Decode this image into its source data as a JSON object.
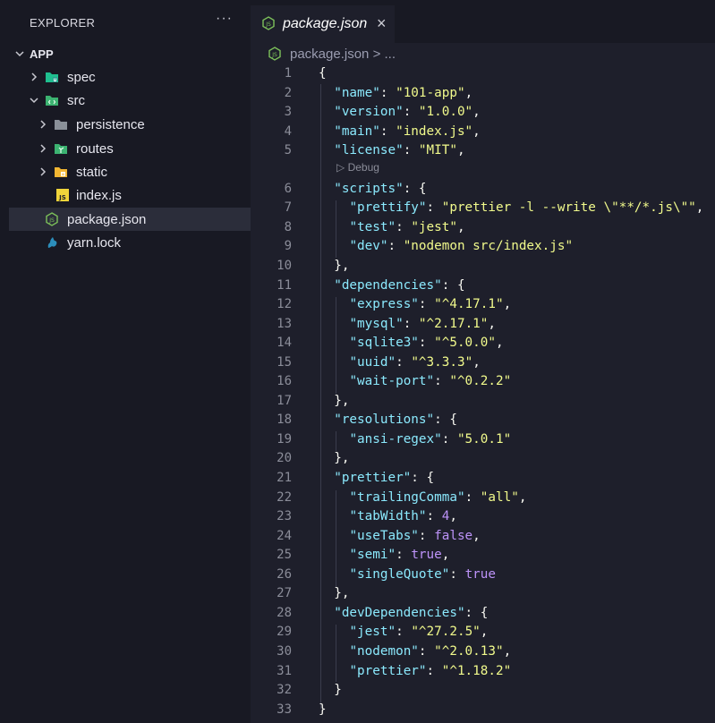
{
  "explorer": {
    "title": "EXPLORER",
    "more": "···",
    "root": "APP",
    "items": [
      {
        "label": "spec",
        "kind": "folder",
        "icon": "test-folder-icon"
      },
      {
        "label": "src",
        "kind": "folder",
        "icon": "src-folder-icon"
      },
      {
        "label": "persistence",
        "kind": "folder",
        "icon": "folder-icon"
      },
      {
        "label": "routes",
        "kind": "folder",
        "icon": "routes-folder-icon"
      },
      {
        "label": "static",
        "kind": "folder",
        "icon": "static-folder-icon"
      },
      {
        "label": "index.js",
        "kind": "file",
        "icon": "js-file-icon"
      },
      {
        "label": "package.json",
        "kind": "file",
        "icon": "nodejs-icon"
      },
      {
        "label": "yarn.lock",
        "kind": "file",
        "icon": "yarn-icon"
      }
    ]
  },
  "tab": {
    "label": "package.json",
    "close": "×"
  },
  "breadcrumb": "package.json > ...",
  "codelens": "▷ Debug",
  "lines": [
    {
      "n": "1",
      "t": [
        [
          "p",
          "{"
        ]
      ]
    },
    {
      "n": "2",
      "t": [
        [
          "p",
          "  "
        ],
        [
          "k",
          "\"name\""
        ],
        [
          "p",
          ": "
        ],
        [
          "s",
          "\"101-app\""
        ],
        [
          "p",
          ","
        ]
      ]
    },
    {
      "n": "3",
      "t": [
        [
          "p",
          "  "
        ],
        [
          "k",
          "\"version\""
        ],
        [
          "p",
          ": "
        ],
        [
          "s",
          "\"1.0.0\""
        ],
        [
          "p",
          ","
        ]
      ]
    },
    {
      "n": "4",
      "t": [
        [
          "p",
          "  "
        ],
        [
          "k",
          "\"main\""
        ],
        [
          "p",
          ": "
        ],
        [
          "s",
          "\"index.js\""
        ],
        [
          "p",
          ","
        ]
      ]
    },
    {
      "n": "5",
      "t": [
        [
          "p",
          "  "
        ],
        [
          "k",
          "\"license\""
        ],
        [
          "p",
          ": "
        ],
        [
          "s",
          "\"MIT\""
        ],
        [
          "p",
          ","
        ]
      ]
    },
    {
      "n": "6",
      "t": [
        [
          "p",
          "  "
        ],
        [
          "k",
          "\"scripts\""
        ],
        [
          "p",
          ": {"
        ]
      ]
    },
    {
      "n": "7",
      "t": [
        [
          "p",
          "    "
        ],
        [
          "k",
          "\"prettify\""
        ],
        [
          "p",
          ": "
        ],
        [
          "s",
          "\"prettier -l --write \\\"**/*.js\\\"\""
        ],
        [
          "p",
          ","
        ]
      ]
    },
    {
      "n": "8",
      "t": [
        [
          "p",
          "    "
        ],
        [
          "k",
          "\"test\""
        ],
        [
          "p",
          ": "
        ],
        [
          "s",
          "\"jest\""
        ],
        [
          "p",
          ","
        ]
      ]
    },
    {
      "n": "9",
      "t": [
        [
          "p",
          "    "
        ],
        [
          "k",
          "\"dev\""
        ],
        [
          "p",
          ": "
        ],
        [
          "s",
          "\"nodemon src/index.js\""
        ]
      ]
    },
    {
      "n": "10",
      "t": [
        [
          "p",
          "  },"
        ]
      ]
    },
    {
      "n": "11",
      "t": [
        [
          "p",
          "  "
        ],
        [
          "k",
          "\"dependencies\""
        ],
        [
          "p",
          ": {"
        ]
      ]
    },
    {
      "n": "12",
      "t": [
        [
          "p",
          "    "
        ],
        [
          "k",
          "\"express\""
        ],
        [
          "p",
          ": "
        ],
        [
          "s",
          "\"^4.17.1\""
        ],
        [
          "p",
          ","
        ]
      ]
    },
    {
      "n": "13",
      "t": [
        [
          "p",
          "    "
        ],
        [
          "k",
          "\"mysql\""
        ],
        [
          "p",
          ": "
        ],
        [
          "s",
          "\"^2.17.1\""
        ],
        [
          "p",
          ","
        ]
      ]
    },
    {
      "n": "14",
      "t": [
        [
          "p",
          "    "
        ],
        [
          "k",
          "\"sqlite3\""
        ],
        [
          "p",
          ": "
        ],
        [
          "s",
          "\"^5.0.0\""
        ],
        [
          "p",
          ","
        ]
      ]
    },
    {
      "n": "15",
      "t": [
        [
          "p",
          "    "
        ],
        [
          "k",
          "\"uuid\""
        ],
        [
          "p",
          ": "
        ],
        [
          "s",
          "\"^3.3.3\""
        ],
        [
          "p",
          ","
        ]
      ]
    },
    {
      "n": "16",
      "t": [
        [
          "p",
          "    "
        ],
        [
          "k",
          "\"wait-port\""
        ],
        [
          "p",
          ": "
        ],
        [
          "s",
          "\"^0.2.2\""
        ]
      ]
    },
    {
      "n": "17",
      "t": [
        [
          "p",
          "  },"
        ]
      ]
    },
    {
      "n": "18",
      "t": [
        [
          "p",
          "  "
        ],
        [
          "k",
          "\"resolutions\""
        ],
        [
          "p",
          ": {"
        ]
      ]
    },
    {
      "n": "19",
      "t": [
        [
          "p",
          "    "
        ],
        [
          "k",
          "\"ansi-regex\""
        ],
        [
          "p",
          ": "
        ],
        [
          "s",
          "\"5.0.1\""
        ]
      ]
    },
    {
      "n": "20",
      "t": [
        [
          "p",
          "  },"
        ]
      ]
    },
    {
      "n": "21",
      "t": [
        [
          "p",
          "  "
        ],
        [
          "k",
          "\"prettier\""
        ],
        [
          "p",
          ": {"
        ]
      ]
    },
    {
      "n": "22",
      "t": [
        [
          "p",
          "    "
        ],
        [
          "k",
          "\"trailingComma\""
        ],
        [
          "p",
          ": "
        ],
        [
          "s",
          "\"all\""
        ],
        [
          "p",
          ","
        ]
      ]
    },
    {
      "n": "23",
      "t": [
        [
          "p",
          "    "
        ],
        [
          "k",
          "\"tabWidth\""
        ],
        [
          "p",
          ": "
        ],
        [
          "n",
          "4"
        ],
        [
          "p",
          ","
        ]
      ]
    },
    {
      "n": "24",
      "t": [
        [
          "p",
          "    "
        ],
        [
          "k",
          "\"useTabs\""
        ],
        [
          "p",
          ": "
        ],
        [
          "b",
          "false"
        ],
        [
          "p",
          ","
        ]
      ]
    },
    {
      "n": "25",
      "t": [
        [
          "p",
          "    "
        ],
        [
          "k",
          "\"semi\""
        ],
        [
          "p",
          ": "
        ],
        [
          "b",
          "true"
        ],
        [
          "p",
          ","
        ]
      ]
    },
    {
      "n": "26",
      "t": [
        [
          "p",
          "    "
        ],
        [
          "k",
          "\"singleQuote\""
        ],
        [
          "p",
          ": "
        ],
        [
          "b",
          "true"
        ]
      ]
    },
    {
      "n": "27",
      "t": [
        [
          "p",
          "  },"
        ]
      ]
    },
    {
      "n": "28",
      "t": [
        [
          "p",
          "  "
        ],
        [
          "k",
          "\"devDependencies\""
        ],
        [
          "p",
          ": {"
        ]
      ]
    },
    {
      "n": "29",
      "t": [
        [
          "p",
          "    "
        ],
        [
          "k",
          "\"jest\""
        ],
        [
          "p",
          ": "
        ],
        [
          "s",
          "\"^27.2.5\""
        ],
        [
          "p",
          ","
        ]
      ]
    },
    {
      "n": "30",
      "t": [
        [
          "p",
          "    "
        ],
        [
          "k",
          "\"nodemon\""
        ],
        [
          "p",
          ": "
        ],
        [
          "s",
          "\"^2.0.13\""
        ],
        [
          "p",
          ","
        ]
      ]
    },
    {
      "n": "31",
      "t": [
        [
          "p",
          "    "
        ],
        [
          "k",
          "\"prettier\""
        ],
        [
          "p",
          ": "
        ],
        [
          "s",
          "\"^1.18.2\""
        ]
      ]
    },
    {
      "n": "32",
      "t": [
        [
          "p",
          "  }"
        ]
      ]
    },
    {
      "n": "33",
      "t": [
        [
          "p",
          "}"
        ]
      ]
    }
  ],
  "colors": {
    "key": "#8be9fd",
    "string": "#f1fa8c",
    "number": "#bd93f9",
    "bg": "#1e1f2b",
    "sidebar": "#181923"
  }
}
